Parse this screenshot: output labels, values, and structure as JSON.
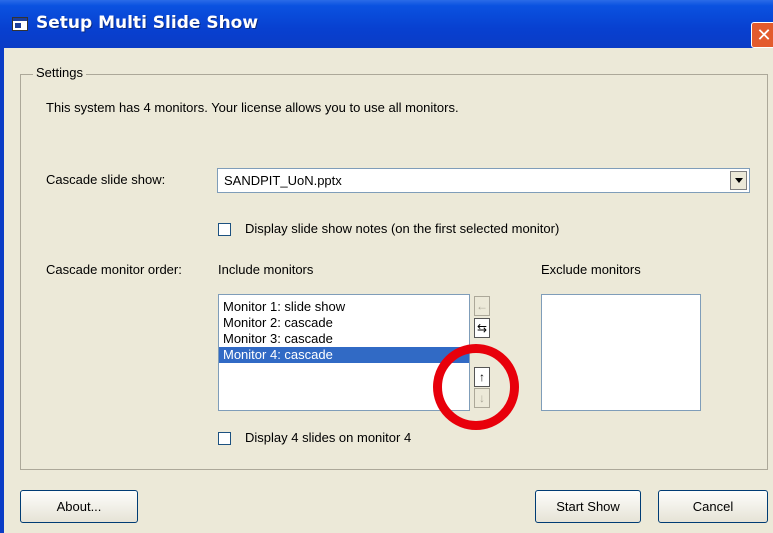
{
  "window": {
    "title": "Setup Multi Slide Show",
    "close_icon": "close-icon"
  },
  "settings": {
    "group_label": "Settings",
    "info_text": "This system has 4 monitors. Your license allows you to use all monitors.",
    "cascade_label": "Cascade slide show:",
    "cascade_value": "SANDPIT_UoN.pptx",
    "notes_checkbox_label": "Display slide show notes (on the first selected monitor)",
    "notes_checked": false,
    "order_label": "Cascade monitor order:",
    "include_label": "Include monitors",
    "exclude_label": "Exclude monitors",
    "include_items": [
      "Monitor 1: slide show",
      "Monitor 2: cascade",
      "Monitor 3: cascade",
      "Monitor 4: cascade"
    ],
    "selected_include_index": 3,
    "exclude_items": [],
    "display_slides_label": "Display 4 slides on monitor 4",
    "display_slides_checked": false
  },
  "buttons": {
    "about": "About...",
    "start": "Start Show",
    "cancel": "Cancel"
  },
  "annotation": {
    "color": "#e8000b",
    "shape": "circle"
  }
}
